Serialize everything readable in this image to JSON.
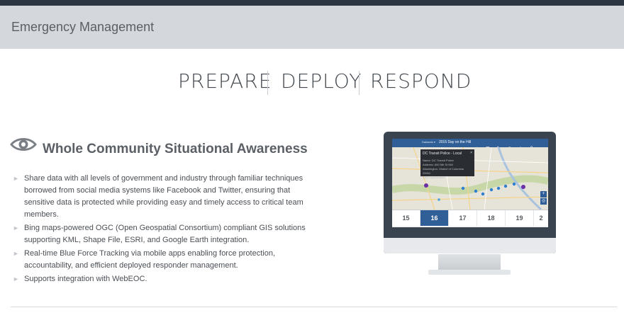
{
  "header": {
    "title": "Emergency Management"
  },
  "tagline": [
    "PREPARE",
    "DEPLOY",
    "RESPOND"
  ],
  "feature": {
    "icon": "eye-icon",
    "title": "Whole Community Situational Awareness",
    "bullets": [
      "Share data with all levels of government and industry through familiar techniques borrowed from social media systems like Facebook and Twitter, ensuring that sensitive data is protected while providing easy and timely access to critical team members.",
      "Bing maps-powered OGC (Open Geospatial Consortium) compliant GIS solutions supporting KML, Shape File, ESRI, and Google Earth integration.",
      "Real-time Blue Force Tracking via mobile apps enabling force protection, accountability, and efficient deployed responder management.",
      "Supports integration with WebEOC."
    ]
  },
  "screen": {
    "app_title": "2015 Day on the Hill",
    "dropdown": "Datasets ▾",
    "toolbar_icons": [
      "home-icon",
      "calendar-icon",
      "edit-icon",
      "layers-icon",
      "download-icon",
      "help-icon",
      "menu-icon"
    ],
    "popup": {
      "title": "DC Transit Police - Local",
      "lines": [
        "Name: DC Transit Police",
        "Address: 600 5th St NW",
        "Washington, District of Columbia 20001",
        "View organization"
      ]
    },
    "timeline_days": [
      "15",
      "16",
      "17",
      "18",
      "19",
      "2"
    ],
    "active_day": "16"
  },
  "colors": {
    "accent": "#2f5f96",
    "header_bg": "#d4d8dc",
    "monitor": "#3a4350"
  }
}
